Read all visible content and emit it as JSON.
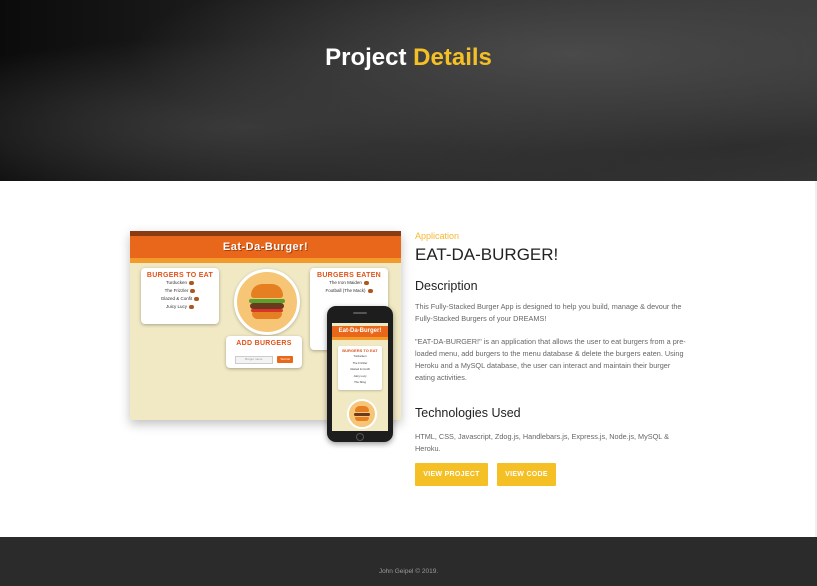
{
  "hero": {
    "title_main": "Project",
    "title_accent": "Details"
  },
  "mockup": {
    "app_name": "Eat-Da-Burger!",
    "eat_card": {
      "title": "BURGERS TO EAT",
      "items": [
        "Turducken",
        "The Frizzler",
        "Glazed & Confit",
        "Juicy Lucy"
      ]
    },
    "eaten_card": {
      "title": "BURGERS EATEN",
      "items": [
        "The Iron Maiden",
        "Football (The Mack)"
      ]
    },
    "add_card": {
      "title": "ADD BURGERS",
      "placeholder": "Burger name",
      "submit_label": "Submit"
    },
    "phone": {
      "app_name": "Eat-Da-Burger!",
      "card_title": "BURGERS TO EAT",
      "items": [
        "Turducken",
        "The Frizzler",
        "Glazed & Confit",
        "Juicy Lucy",
        "The Sling"
      ]
    }
  },
  "details": {
    "category": "Application",
    "title": "EAT-DA-BURGER!",
    "description_heading": "Description",
    "description_p1": "This Fully-Stacked Burger App is designed to help you build, manage & devour the Fully-Stacked Burgers of your DREAMS!",
    "description_p2": "\"EAT-DA-BURGER!\" is an application that allows the user to eat burgers from a pre-loaded menu, add burgers to the menu database & delete the burgers eaten. Using Heroku and a MySQL database, the user can interact and maintain their burger eating activities.",
    "tech_heading": "Technologies Used",
    "tech_text": "HTML, CSS, Javascript, Zdog.js, Handlebars.js, Express.js, Node.js, MySQL & Heroku.",
    "view_project_label": "VIEW PROJECT",
    "view_code_label": "VIEW CODE"
  },
  "footer": {
    "text": "John Geipel © 2019."
  },
  "colors": {
    "accent": "#f5c026",
    "hero_bg": "#1e1e1e",
    "footer_bg": "#2b2b2b",
    "burger_orange": "#e9671a"
  }
}
